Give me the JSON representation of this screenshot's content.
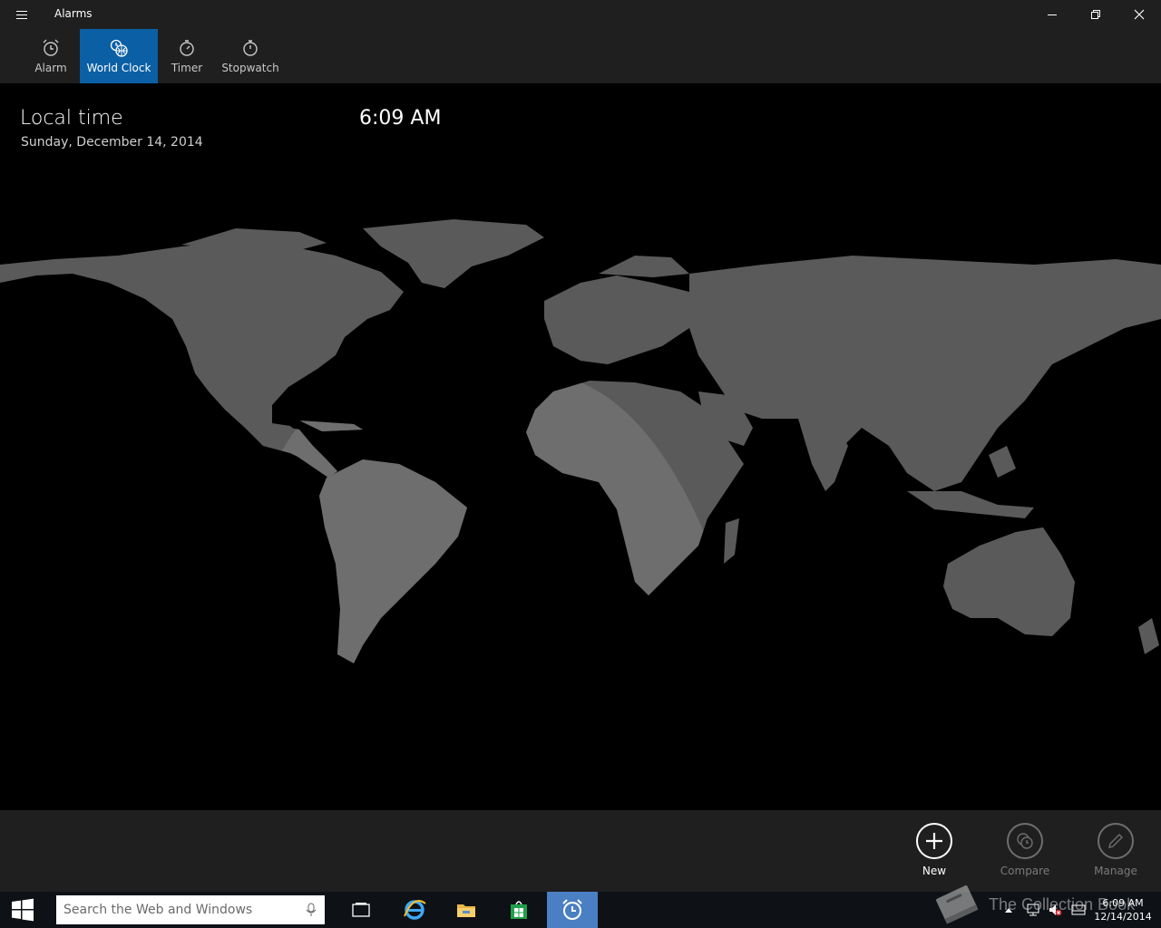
{
  "window": {
    "title": "Alarms",
    "controls": {
      "minimize_icon": "minimize-icon",
      "restore_icon": "restore-icon",
      "close_icon": "close-icon"
    }
  },
  "tabs": [
    {
      "label": "Alarm",
      "icon": "alarm-clock-icon",
      "active": false
    },
    {
      "label": "World Clock",
      "icon": "world-clock-icon",
      "active": true
    },
    {
      "label": "Timer",
      "icon": "timer-icon",
      "active": false
    },
    {
      "label": "Stopwatch",
      "icon": "stopwatch-icon",
      "active": false
    }
  ],
  "local": {
    "title": "Local time",
    "date": "Sunday, December 14, 2014",
    "time": "6:09 AM"
  },
  "commands": [
    {
      "label": "New",
      "icon": "plus-icon",
      "enabled": true
    },
    {
      "label": "Compare",
      "icon": "compare-clock-icon",
      "enabled": false
    },
    {
      "label": "Manage",
      "icon": "pencil-icon",
      "enabled": false
    }
  ],
  "taskbar": {
    "search_placeholder": "Search the Web and Windows",
    "apps": [
      "task-view-icon",
      "internet-explorer-icon",
      "file-explorer-icon",
      "store-icon",
      "alarms-app-icon"
    ],
    "clock": {
      "time": "6:09 AM",
      "date": "12/14/2014"
    }
  },
  "watermark": {
    "text": "The Collection Book"
  },
  "colors": {
    "accent": "#0b5fa5",
    "chrome": "#1f1f1f",
    "land": "#5a5a5a",
    "daylight_land": "#6e6e6e",
    "taskbar": "#0e1116",
    "active_taskbar_app": "#4a7fc4"
  }
}
